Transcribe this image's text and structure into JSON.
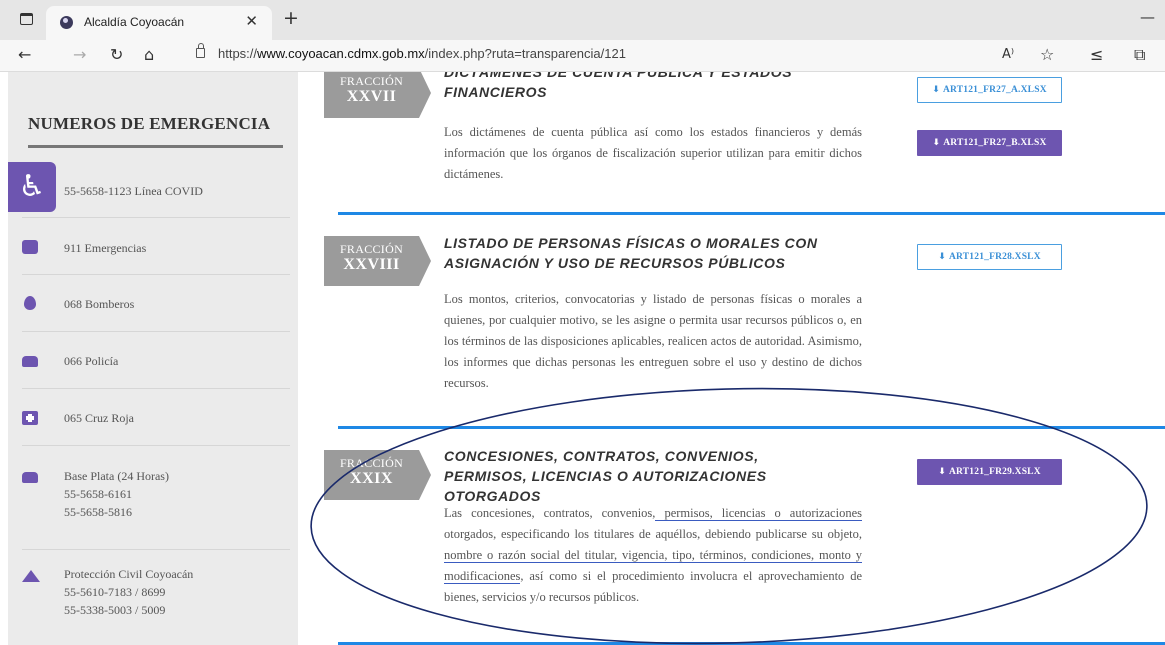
{
  "browser": {
    "tab_title": "Alcaldía Coyoacán",
    "tab_close": "✕",
    "new_tab": "+",
    "minimize": "—",
    "url_prefix": "https://",
    "url_host": "www.coyoacan.cdmx.gob.mx",
    "url_path": "/index.php?ruta=transparencia/121",
    "icons": [
      "back-icon",
      "forward-icon",
      "reload-icon",
      "home-icon",
      "lock-icon",
      "read-aloud-icon",
      "favorite-add-icon",
      "favorites-icon",
      "collections-icon"
    ]
  },
  "sidebar": {
    "title": "NUMEROS DE EMERGENCIA",
    "accessibility_glyph": "♿",
    "items": [
      {
        "icon": "virus-icon",
        "lines": [
          "55-5658-1123 Línea COVID"
        ]
      },
      {
        "icon": "ambulance-icon",
        "lines": [
          "911 Emergencias"
        ]
      },
      {
        "icon": "fire-icon",
        "lines": [
          "068 Bomberos"
        ]
      },
      {
        "icon": "police-car-icon",
        "lines": [
          "066 Policía"
        ]
      },
      {
        "icon": "medical-cross-icon",
        "lines": [
          "065 Cruz Roja"
        ]
      },
      {
        "icon": "car-icon",
        "lines": [
          "Base Plata (24 Horas)",
          "55-5658-6161",
          "55-5658-5816"
        ]
      },
      {
        "icon": "tent-icon",
        "lines": [
          "Protección Civil Coyoacán",
          "55-5610-7183 / 8699",
          "55-5338-5003 / 5009"
        ]
      }
    ]
  },
  "sections": [
    {
      "fraccion_label": "FRACCIÓN",
      "numeral": "XXVII",
      "heading": "DICTÁMENES DE CUENTA PÚBLICA Y ESTADOS FINANCIEROS",
      "description": "Los dictámenes de cuenta pública así como los estados financieros y demás información que los órganos de fiscalización superior utilizan para emitir dichos dictámenes.",
      "buttons": [
        {
          "label": "ART121_FR27_A.XLSX",
          "style": "outline"
        },
        {
          "label": "ART121_FR27_B.XLSX",
          "style": "filled"
        }
      ]
    },
    {
      "fraccion_label": "FRACCIÓN",
      "numeral": "XXVIII",
      "heading": "LISTADO DE PERSONAS FÍSICAS O MORALES CON ASIGNACIÓN Y USO DE RECURSOS PÚBLICOS",
      "description": "Los montos, criterios, convocatorias y listado de personas físicas o morales a quienes, por cualquier motivo, se les asigne o permita usar recursos públicos o, en los términos de las disposiciones aplicables, realicen actos de autoridad. Asimismo, los informes que dichas personas les entreguen sobre el uso y destino de dichos recursos.",
      "buttons": [
        {
          "label": "ART121_FR28.XSLX",
          "style": "outline"
        }
      ]
    },
    {
      "fraccion_label": "FRACCIÓN",
      "numeral": "XXIX",
      "heading": "CONCESIONES, CONTRATOS, CONVENIOS, PERMISOS, LICENCIAS O AUTORIZACIONES OTORGADOS",
      "description_parts": [
        "Las concesiones, contratos, convenios,",
        " permisos, licencias o autorizaciones",
        " otorgados, especificando los titulares de aquéllos, debiendo publicarse su objeto, ",
        "nombre o razón social del titular, vigencia, tipo, términos, condiciones, monto y modificaciones",
        ", así como si el procedimiento involucra el aprovechamiento de bienes, servicios y/o recursos públicos."
      ],
      "buttons": [
        {
          "label": "ART121_FR29.XSLX",
          "style": "filled"
        }
      ]
    }
  ],
  "download_glyph": "⬇",
  "colors": {
    "accent_purple": "#6d55b0",
    "rule_blue": "#1e88e5",
    "annotation_navy": "#1a2a6b"
  }
}
